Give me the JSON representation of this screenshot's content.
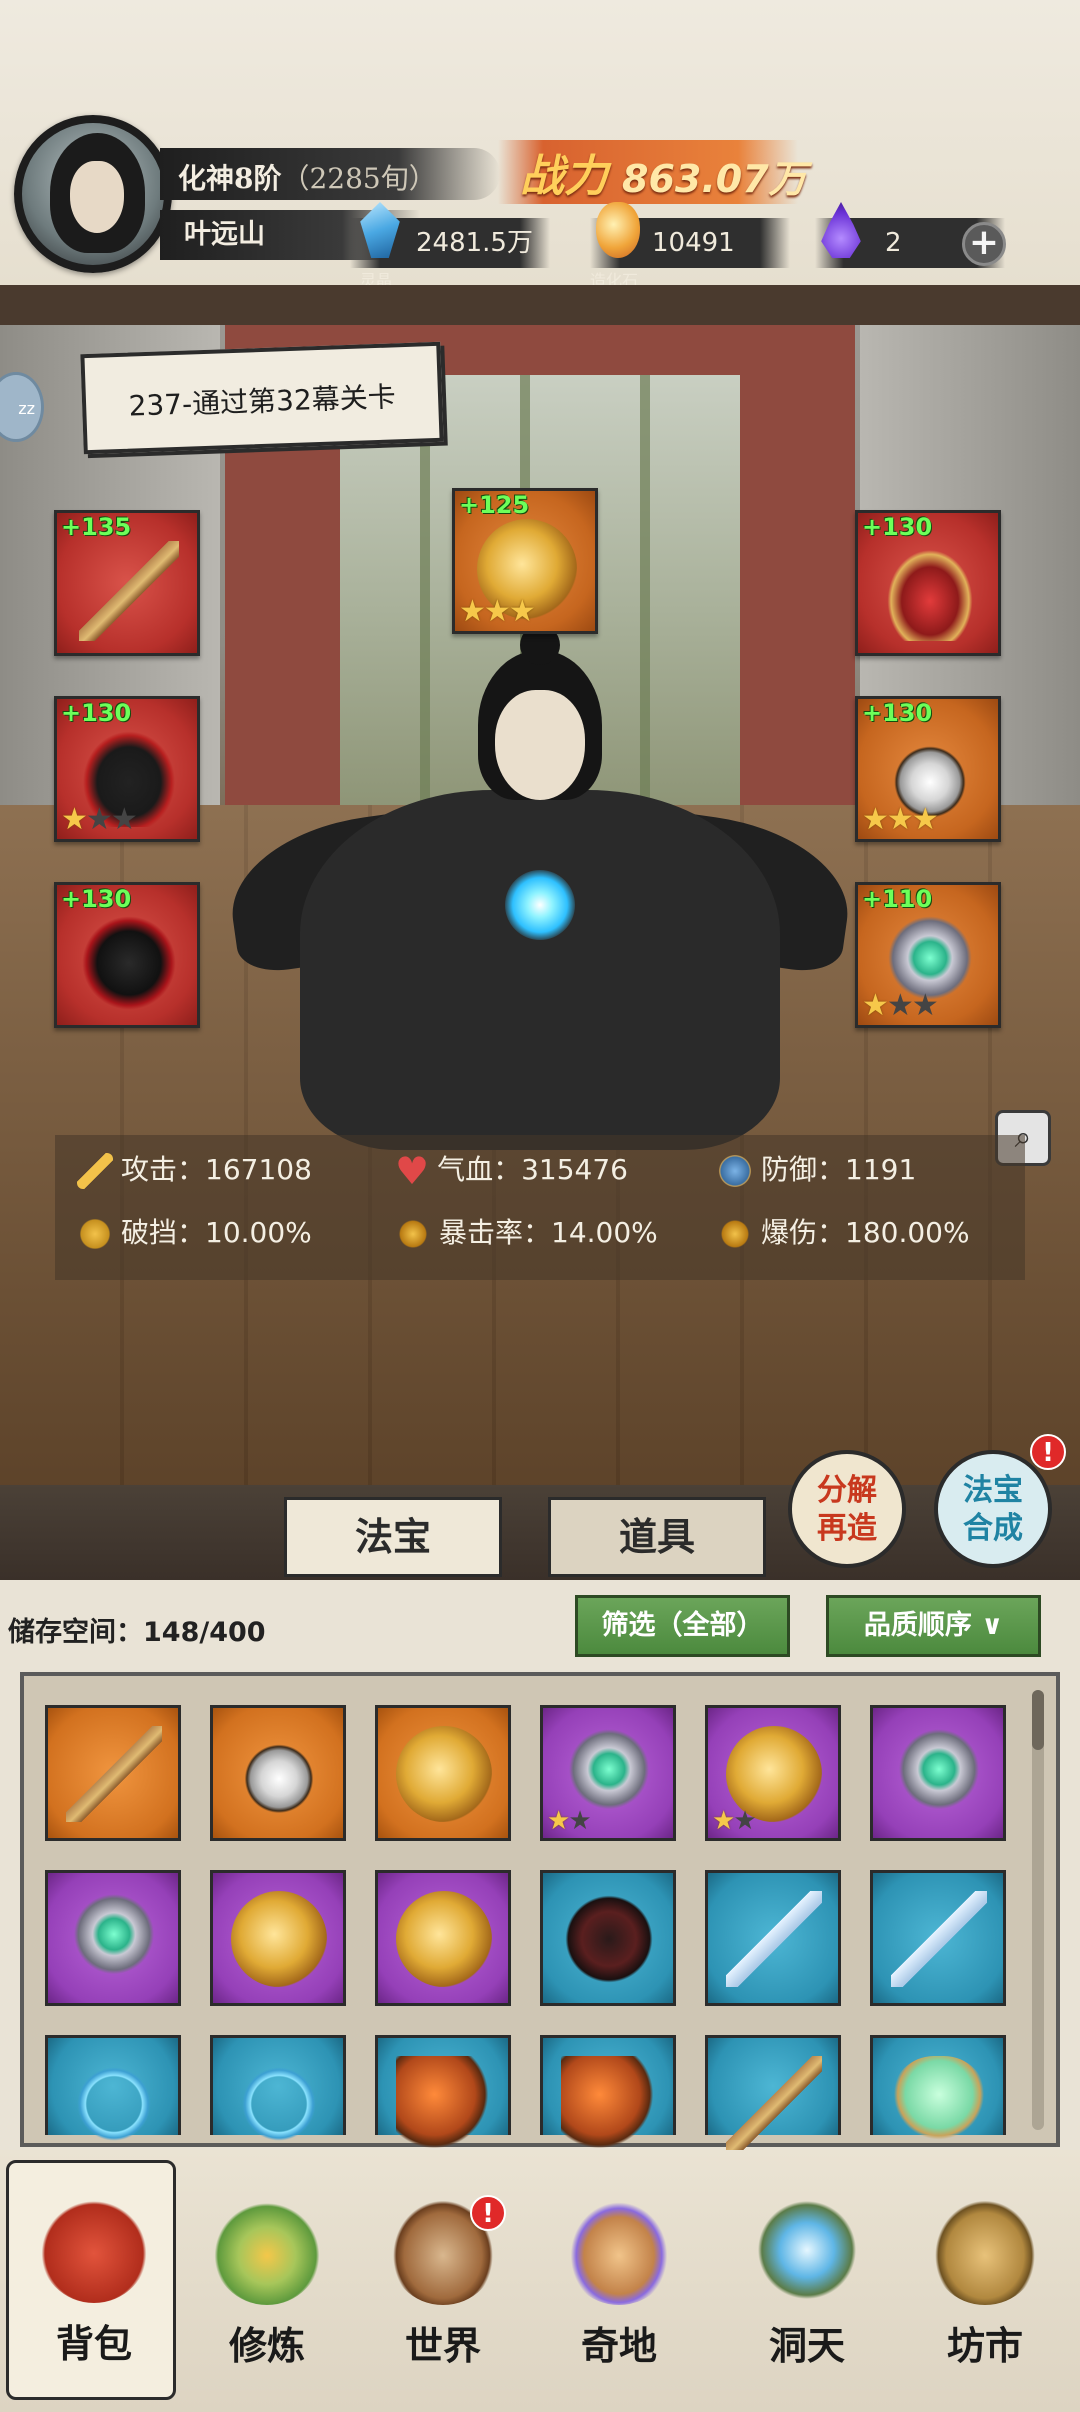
{
  "header": {
    "realm": "化神8阶",
    "realm_detail": "（2285旬）",
    "player_name": "叶远山",
    "power_label": "战力",
    "power_value": "863.07万",
    "resources": [
      {
        "icon": "spirit-crystal-icon",
        "label": "灵晶",
        "value": "2481.5万"
      },
      {
        "icon": "creation-stone-icon",
        "label": "造化石",
        "value": "10491"
      },
      {
        "icon": "purple-flame-icon",
        "label": "",
        "value": "2"
      }
    ]
  },
  "scene": {
    "quest_text": "237-通过第32幕关卡",
    "idle_badge": "zz",
    "equipment_slots": [
      {
        "position": "left-1",
        "rarity": "red",
        "bonus": "+135",
        "item": "staff",
        "stars": null
      },
      {
        "position": "center-top",
        "rarity": "orange",
        "bonus": "+125",
        "item": "dragon",
        "stars": [
          1,
          1,
          1
        ]
      },
      {
        "position": "right-1",
        "rarity": "red",
        "bonus": "+130",
        "item": "crown",
        "stars": null
      },
      {
        "position": "left-2",
        "rarity": "red",
        "bonus": "+130",
        "item": "robe",
        "stars": [
          1,
          0,
          0
        ]
      },
      {
        "position": "right-2",
        "rarity": "orange",
        "bonus": "+130",
        "item": "amulet",
        "stars": [
          1,
          1,
          1
        ]
      },
      {
        "position": "left-3",
        "rarity": "red",
        "bonus": "+130",
        "item": "helmet",
        "stars": null
      },
      {
        "position": "right-3",
        "rarity": "orange",
        "bonus": "+110",
        "item": "ring",
        "stars": [
          1,
          0,
          0
        ]
      }
    ],
    "stats": [
      {
        "icon": "sword-icon",
        "label": "攻击：",
        "value": "167108"
      },
      {
        "icon": "heart-icon",
        "label": "气血：",
        "value": "315476"
      },
      {
        "icon": "shield-icon",
        "label": "防御：",
        "value": "1191"
      },
      {
        "icon": "armor-break-icon",
        "label": "破挡：",
        "value": "10.00%"
      },
      {
        "icon": "crit-rate-icon",
        "label": "暴击率：",
        "value": "14.00%"
      },
      {
        "icon": "crit-damage-icon",
        "label": "爆伤：",
        "value": "180.00%"
      }
    ]
  },
  "tabs": {
    "treasure": "法宝",
    "items": "道具",
    "decompose_line1": "分解",
    "decompose_line2": "再造",
    "merge_line1": "法宝",
    "merge_line2": "合成",
    "merge_badge": "!"
  },
  "inventory": {
    "storage_label": "储存空间：",
    "storage_value": "148/400",
    "filter_label": "筛选（全部）",
    "sort_label": "品质顺序",
    "rows": [
      [
        {
          "rarity": "orange",
          "item": "staff",
          "stars": null
        },
        {
          "rarity": "orange",
          "item": "amulet",
          "stars": null
        },
        {
          "rarity": "orange",
          "item": "dragon",
          "stars": null
        },
        {
          "rarity": "purple",
          "item": "ring",
          "stars": [
            1,
            0
          ]
        },
        {
          "rarity": "purple",
          "item": "dragon",
          "stars": [
            1,
            0
          ]
        },
        {
          "rarity": "purple",
          "item": "ring",
          "stars": null
        }
      ],
      [
        {
          "rarity": "purple",
          "item": "ring",
          "stars": null
        },
        {
          "rarity": "purple",
          "item": "dragon",
          "stars": null
        },
        {
          "rarity": "purple",
          "item": "dragon",
          "stars": null
        },
        {
          "rarity": "blue",
          "item": "gear",
          "stars": null
        },
        {
          "rarity": "blue",
          "item": "sword",
          "stars": null
        },
        {
          "rarity": "blue",
          "item": "sword",
          "stars": null
        }
      ],
      [
        {
          "rarity": "blue",
          "item": "bow",
          "stars": null
        },
        {
          "rarity": "blue",
          "item": "bow",
          "stars": null
        },
        {
          "rarity": "blue",
          "item": "axe",
          "stars": null
        },
        {
          "rarity": "blue",
          "item": "axe",
          "stars": null
        },
        {
          "rarity": "blue",
          "item": "staff",
          "stars": null
        },
        {
          "rarity": "blue",
          "item": "mirror",
          "stars": null
        }
      ]
    ]
  },
  "nav": [
    {
      "label": "背包",
      "icon": "bag-icon",
      "active": true
    },
    {
      "label": "修炼",
      "icon": "cultivate-icon",
      "active": false
    },
    {
      "label": "世界",
      "icon": "world-icon",
      "active": false,
      "badge": "!"
    },
    {
      "label": "奇地",
      "icon": "wonderland-icon",
      "active": false
    },
    {
      "label": "洞天",
      "icon": "cave-icon",
      "active": false
    },
    {
      "label": "坊市",
      "icon": "market-icon",
      "active": false
    }
  ]
}
